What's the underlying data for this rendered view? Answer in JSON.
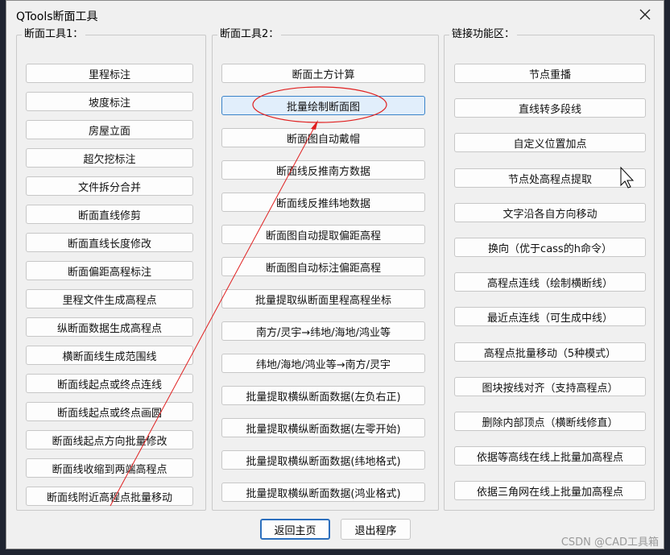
{
  "window": {
    "title": "QTools断面工具"
  },
  "groups": {
    "g1": {
      "title": "断面工具1：",
      "buttons": [
        "里程标注",
        "坡度标注",
        "房屋立面",
        "超欠挖标注",
        "文件拆分合并",
        "断面直线修剪",
        "断面直线长度修改",
        "断面偏距高程标注",
        "里程文件生成高程点",
        "纵断面数据生成高程点",
        "横断面线生成范围线",
        "断面线起点或终点连线",
        "断面线起点或终点画圆",
        "断面线起点方向批量修改",
        "断面线收缩到两端高程点",
        "断面线附近高程点批量移动"
      ]
    },
    "g2": {
      "title": "断面工具2：",
      "buttons": [
        "断面土方计算",
        "批量绘制断面图",
        "断面图自动戴帽",
        "断面线反推南方数据",
        "断面线反推纬地数据",
        "断面图自动提取偏距高程",
        "断面图自动标注偏距高程",
        "批量提取纵断面里程高程坐标",
        "南方/灵宇→纬地/海地/鸿业等",
        "纬地/海地/鸿业等→南方/灵宇",
        "批量提取横纵断面数据(左负右正)",
        "批量提取横纵断面数据(左零开始)",
        "批量提取横纵断面数据(纬地格式)",
        "批量提取横纵断面数据(鸿业格式)"
      ]
    },
    "g3": {
      "title": "链接功能区：",
      "buttons": [
        "节点重播",
        "直线转多段线",
        "自定义位置加点",
        "节点处高程点提取",
        "文字沿各自方向移动",
        "换向（优于cass的h命令）",
        "高程点连线（绘制横断线）",
        "最近点连线（可生成中线）",
        "高程点批量移动（5种模式）",
        "图块按线对齐（支持高程点）",
        "删除内部顶点（横断线修直）",
        "依据等高线在线上批量加高程点",
        "依据三角网在线上批量加高程点"
      ]
    }
  },
  "highlighted_button": "批量绘制断面图",
  "footer": {
    "back": "返回主页",
    "exit": "退出程序"
  },
  "watermark": "CSDN @CAD工具箱",
  "colors": {
    "annotation": "#e02020",
    "highlight_border": "#3a83c9",
    "highlight_bg": "#e1eefb"
  }
}
